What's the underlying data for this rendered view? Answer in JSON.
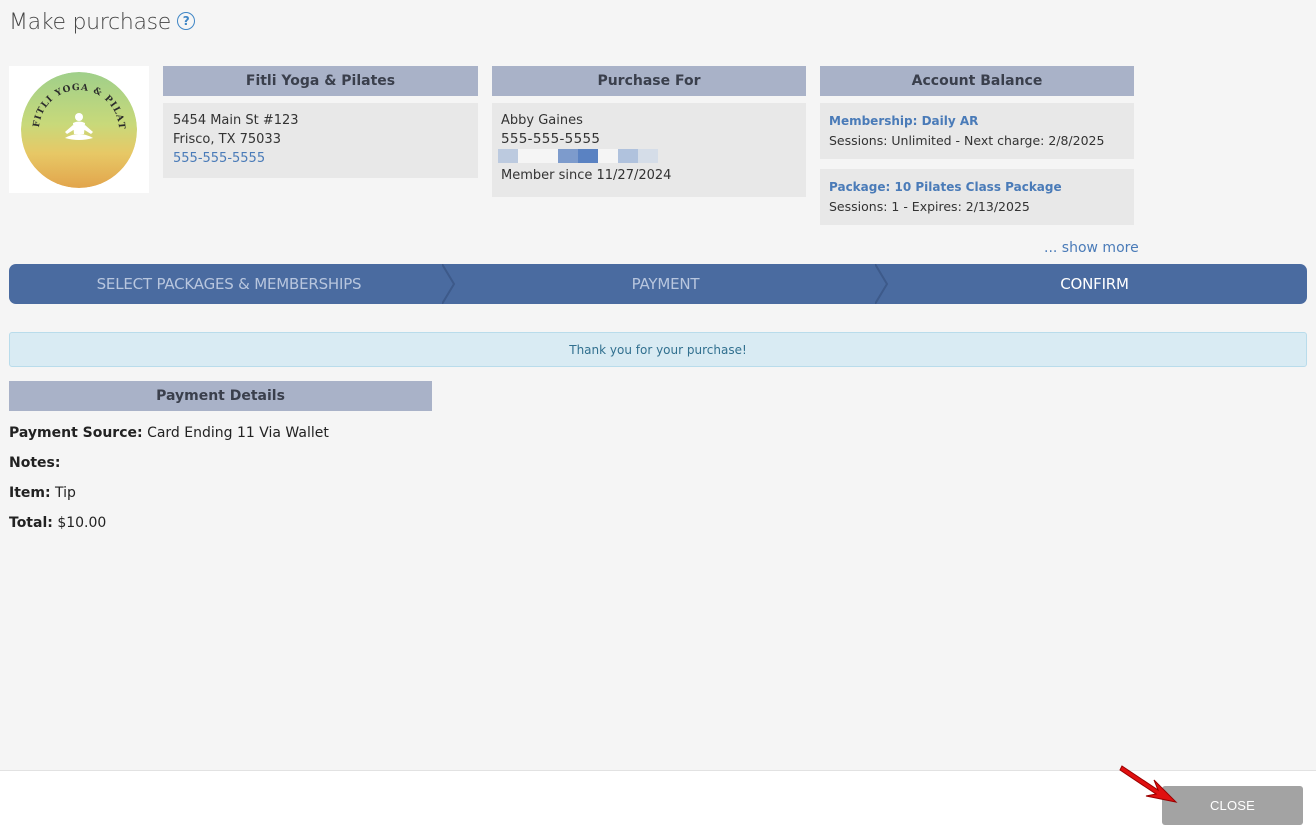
{
  "header": {
    "title": "Make purchase",
    "help_icon": "question-circle-icon"
  },
  "logo": {
    "text": "FITLI YOGA & PILATES"
  },
  "store": {
    "name": "Fitli Yoga & Pilates",
    "address1": "5454 Main St #123",
    "address2": "Frisco, TX 75033",
    "phone": "555-555-5555"
  },
  "purchase_for": {
    "title": "Purchase For",
    "name": "Abby Gaines",
    "phone": "555-555-5555",
    "member_since": "Member since 11/27/2024",
    "pixel_colors": [
      "#bccadf",
      "#f5f5f5",
      "#f5f5f5",
      "#7d9bcc",
      "#5a82c2",
      "#f5f5f5",
      "#b0c2dd",
      "#d5dde8"
    ]
  },
  "balance": {
    "title": "Account Balance",
    "items": [
      {
        "title": "Membership: Daily AR",
        "detail": "Sessions: Unlimited -  Next charge: 2/8/2025"
      },
      {
        "title": "Package: 10 Pilates Class Package",
        "detail": "Sessions: 1 -  Expires: 2/13/2025"
      }
    ],
    "show_more": "... show more"
  },
  "steps": [
    "SELECT PACKAGES & MEMBERSHIPS",
    "PAYMENT",
    "CONFIRM"
  ],
  "alert": "Thank you for your purchase!",
  "payment_details": {
    "title": "Payment Details",
    "source_label": "Payment Source:",
    "source_value": "Card Ending 11 Via Wallet",
    "notes_label": "Notes:",
    "notes_value": "",
    "item_label": "Item:",
    "item_value": "Tip",
    "total_label": "Total:",
    "total_value": "$10.00"
  },
  "footer": {
    "close_label": "CLOSE"
  },
  "colors": {
    "accent": "#4a6ba0",
    "header_bg": "#a9b2c8",
    "link": "#4a7bb8",
    "annotation_arrow": "#e01010"
  }
}
